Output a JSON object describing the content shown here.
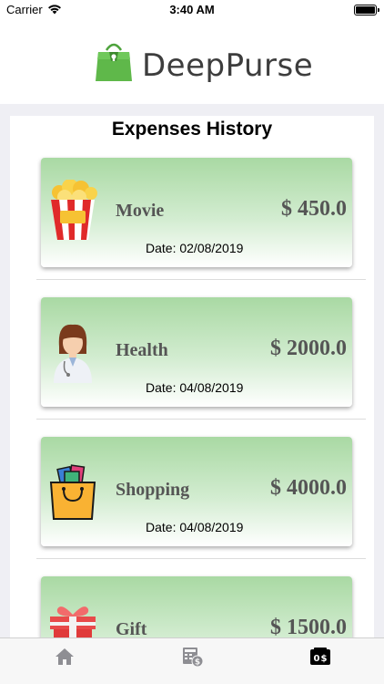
{
  "status_bar": {
    "carrier": "Carrier",
    "time": "3:40 AM"
  },
  "header": {
    "app_name": "DeepPurse",
    "icon": "wallet-bag-logo"
  },
  "history": {
    "title": "Expenses History",
    "items": [
      {
        "category": "Movie",
        "amount": "$ 450.0",
        "date": "Date: 02/08/2019",
        "icon": "popcorn-icon"
      },
      {
        "category": "Health",
        "amount": "$ 2000.0",
        "date": "Date: 04/08/2019",
        "icon": "doctor-icon"
      },
      {
        "category": "Shopping",
        "amount": "$ 4000.0",
        "date": "Date: 04/08/2019",
        "icon": "shopping-bag-icon"
      },
      {
        "category": "Gift",
        "amount": "$ 1500.0",
        "date": "",
        "icon": "gift-icon"
      }
    ]
  },
  "tabbar": {
    "tabs": [
      {
        "name": "home",
        "icon": "home-icon",
        "active": false
      },
      {
        "name": "budget",
        "icon": "calculator-dollar-icon",
        "active": false
      },
      {
        "name": "expenses",
        "icon": "wallet-dollar-icon",
        "active": true
      }
    ]
  },
  "colors": {
    "card_top": "#a9d9a3",
    "card_bottom": "#ffffff",
    "text_amount": "#555555",
    "logo_green": "#5fb84a"
  }
}
